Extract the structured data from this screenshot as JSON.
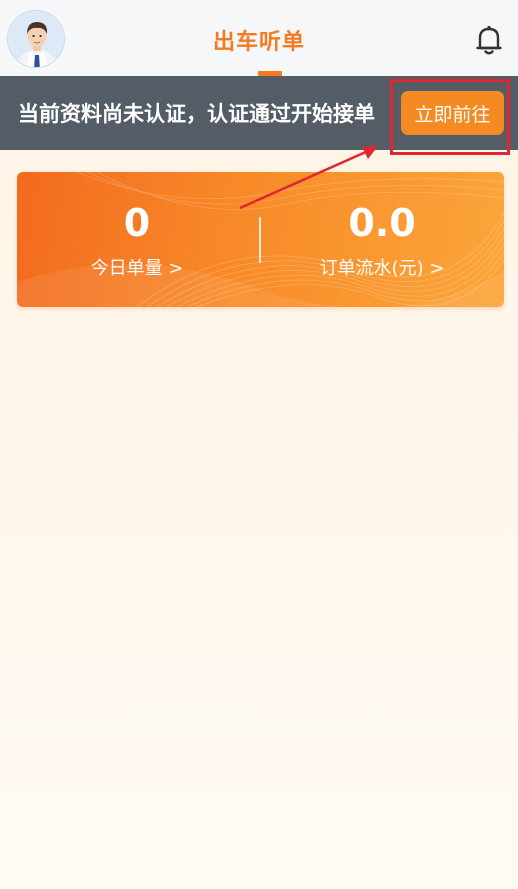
{
  "header": {
    "title": "出车听单",
    "avatar_icon": "driver-avatar",
    "bell_icon": "bell-icon"
  },
  "notice": {
    "text": "当前资料尚未认证，认证通过开始接单",
    "button_label": "立即前往"
  },
  "stats": {
    "today_orders": {
      "value": "0",
      "label": "今日单量 >"
    },
    "order_revenue": {
      "value": "0.0",
      "label": "订单流水(元) >"
    }
  },
  "colors": {
    "accent": "#f47a1f",
    "notice_bg": "#545d66",
    "button": "#f58a23",
    "highlight": "#e0262f"
  }
}
